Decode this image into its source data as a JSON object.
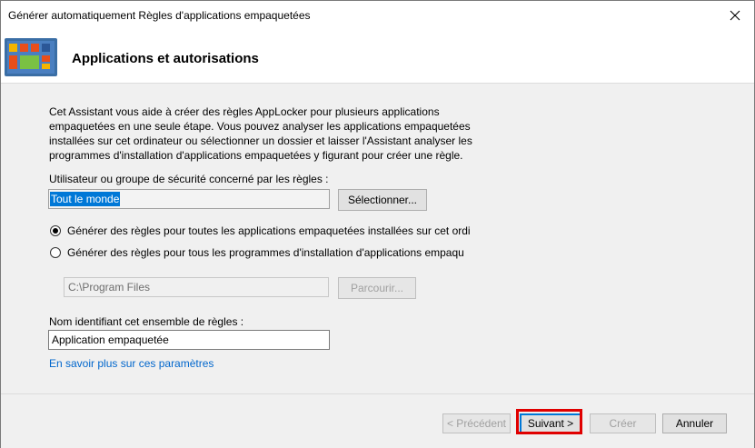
{
  "window": {
    "title": "Générer automatiquement Règles d'applications empaquetées"
  },
  "header": {
    "title": "Applications et autorisations",
    "icon": "app-grid-icon"
  },
  "intro": "Cet Assistant vous aide à créer des règles AppLocker pour plusieurs applications empaquetées en une seule étape. Vous pouvez analyser les applications empaquetées installées sur cet ordinateur ou sélectionner un dossier et laisser l'Assistant analyser les programmes d'installation d'applications empaquetées y figurant pour créer une règle.",
  "user_group": {
    "label": "Utilisateur ou groupe de sécurité concerné par les règles :",
    "value": "Tout le monde",
    "select_button": "Sélectionner..."
  },
  "options": {
    "installed": "Générer des règles pour toutes les applications empaquetées installées sur cet ordi",
    "installers": "Générer des règles pour tous les programmes d'installation d'applications empaqu",
    "selected": "installed"
  },
  "folder": {
    "value": "C:\\Program Files",
    "browse_button": "Parcourir..."
  },
  "rule_name": {
    "label": "Nom identifiant cet ensemble de règles :",
    "value": "Application empaquetée"
  },
  "link": "En savoir plus sur ces paramètres",
  "footer": {
    "previous": "< Précédent",
    "next": "Suivant >",
    "create": "Créer",
    "cancel": "Annuler"
  },
  "colors": {
    "highlight": "#e00000",
    "link": "#0066cc",
    "selection": "#0078d7"
  }
}
